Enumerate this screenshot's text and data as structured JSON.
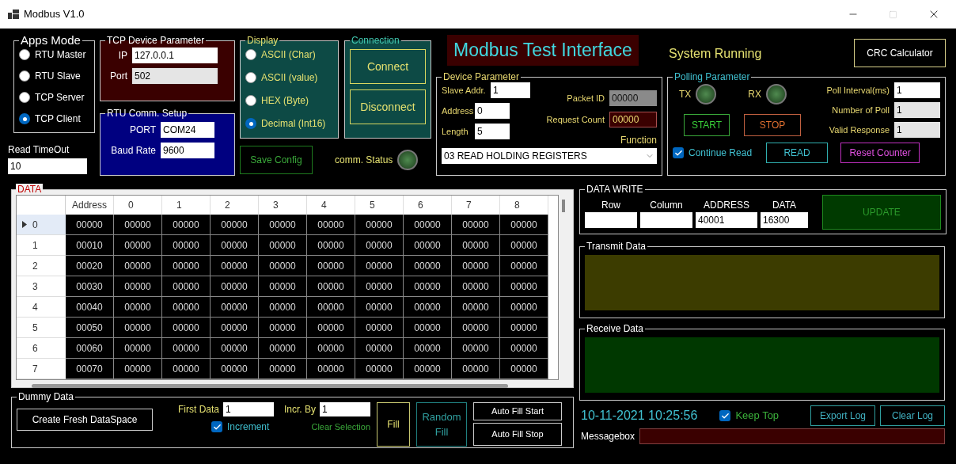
{
  "window": {
    "title": "Modbus V1.0"
  },
  "apps_mode": {
    "title": "Apps Mode",
    "options": [
      {
        "label": "RTU Master",
        "selected": false
      },
      {
        "label": "RTU Slave",
        "selected": false
      },
      {
        "label": "TCP Server",
        "selected": false
      },
      {
        "label": "TCP Client",
        "selected": true
      }
    ]
  },
  "read_timeout": {
    "label": "Read TimeOut",
    "value": "10"
  },
  "tcp_device_parameter": {
    "title": "TCP Device Parameter",
    "fields": [
      {
        "label": "IP",
        "value": "127.0.0.1",
        "disabled": false
      },
      {
        "label": "Port",
        "value": "502",
        "disabled": true
      }
    ]
  },
  "rtu_comm_setup": {
    "title": "RTU Comm. Setup",
    "fields": [
      {
        "label": "PORT",
        "value": "COM24"
      },
      {
        "label": "Baud Rate",
        "value": "9600"
      }
    ]
  },
  "display": {
    "title": "Display",
    "options": [
      {
        "label": "ASCII (Char)",
        "selected": false
      },
      {
        "label": "ASCII (value)",
        "selected": false
      },
      {
        "label": "HEX (Byte)",
        "selected": false
      },
      {
        "label": "Decimal (Int16)",
        "selected": true
      }
    ]
  },
  "connection": {
    "title": "Connection",
    "buttons": [
      "Connect",
      "Disconnect"
    ]
  },
  "save_config": "Save Config",
  "comm_status": "comm. Status",
  "header": {
    "title": "Modbus Test Interface",
    "status": "System Running",
    "crc_button": "CRC Calculator"
  },
  "device_parameter": {
    "title": "Device Parameter",
    "left_fields": [
      {
        "label": "Slave Addr.",
        "value": "1"
      },
      {
        "label": "Address",
        "value": "0"
      },
      {
        "label": "Length",
        "value": "5"
      }
    ],
    "packet_id": {
      "label": "Packet ID",
      "value": "00000"
    },
    "request_count": {
      "label": "Request Count",
      "value": "00000"
    },
    "function_label": "Function",
    "function_value": "03 READ HOLDING REGISTERS"
  },
  "polling_parameter": {
    "title": "Polling Parameter",
    "tx": "TX",
    "rx": "RX",
    "start": "START",
    "stop": "STOP",
    "fields": [
      {
        "label": "Poll Interval(ms)",
        "value": "1",
        "disabled": false
      },
      {
        "label": "Number of Poll",
        "value": "1",
        "disabled": true
      },
      {
        "label": "Valid Response",
        "value": "1",
        "disabled": true
      }
    ],
    "continue_read": {
      "label": "Continue Read",
      "checked": true
    },
    "read": "READ",
    "reset": "Reset Counter"
  },
  "data": {
    "title": "DATA",
    "columns": [
      "Address",
      "0",
      "1",
      "2",
      "3",
      "4",
      "5",
      "6",
      "7",
      "8"
    ],
    "rows": [
      {
        "index": "0",
        "selected": true,
        "cells": [
          "00000",
          "00000",
          "00000",
          "00000",
          "00000",
          "00000",
          "00000",
          "00000",
          "00000",
          "00000"
        ]
      },
      {
        "index": "1",
        "selected": false,
        "cells": [
          "00010",
          "00000",
          "00000",
          "00000",
          "00000",
          "00000",
          "00000",
          "00000",
          "00000",
          "00000"
        ]
      },
      {
        "index": "2",
        "selected": false,
        "cells": [
          "00020",
          "00000",
          "00000",
          "00000",
          "00000",
          "00000",
          "00000",
          "00000",
          "00000",
          "00000"
        ]
      },
      {
        "index": "3",
        "selected": false,
        "cells": [
          "00030",
          "00000",
          "00000",
          "00000",
          "00000",
          "00000",
          "00000",
          "00000",
          "00000",
          "00000"
        ]
      },
      {
        "index": "4",
        "selected": false,
        "cells": [
          "00040",
          "00000",
          "00000",
          "00000",
          "00000",
          "00000",
          "00000",
          "00000",
          "00000",
          "00000"
        ]
      },
      {
        "index": "5",
        "selected": false,
        "cells": [
          "00050",
          "00000",
          "00000",
          "00000",
          "00000",
          "00000",
          "00000",
          "00000",
          "00000",
          "00000"
        ]
      },
      {
        "index": "6",
        "selected": false,
        "cells": [
          "00060",
          "00000",
          "00000",
          "00000",
          "00000",
          "00000",
          "00000",
          "00000",
          "00000",
          "00000"
        ]
      },
      {
        "index": "7",
        "selected": false,
        "cells": [
          "00070",
          "00000",
          "00000",
          "00000",
          "00000",
          "00000",
          "00000",
          "00000",
          "00000",
          "00000"
        ]
      }
    ]
  },
  "data_write": {
    "title": "DATA WRITE",
    "fields": [
      {
        "label": "Row"
      },
      {
        "label": "Column"
      },
      {
        "label": "ADDRESS",
        "value": "40001"
      },
      {
        "label": "DATA",
        "value": "16300"
      }
    ],
    "update": "UPDATE"
  },
  "transmit_data": {
    "title": "Transmit Data"
  },
  "receive_data": {
    "title": "Receive Data"
  },
  "datetime": "10-11-2021 10:25:56",
  "keep_top": {
    "label": "Keep Top",
    "checked": true
  },
  "export_log": "Export Log",
  "clear_log": "Clear Log",
  "messagebox": "Messagebox",
  "dummy_data": {
    "title": "Dummy Data",
    "create": "Create Fresh DataSpace",
    "first_data": {
      "label": "First Data",
      "value": "1"
    },
    "incr_by": {
      "label": "Incr. By",
      "value": "1"
    },
    "increment": {
      "label": "Increment",
      "checked": true
    },
    "clear_selection": "Clear Selection",
    "fill": "Fill",
    "random_fill": "Random Fill",
    "auto_fill_start": "Auto Fill Start",
    "auto_fill_stop": "Auto Fill Stop"
  }
}
